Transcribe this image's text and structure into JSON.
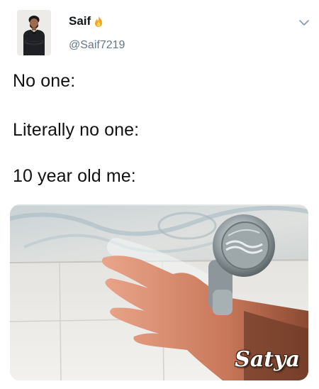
{
  "tweet": {
    "author": {
      "display_name": "Saif",
      "name_emoji_icon": "fire-icon",
      "handle": "@Saif7219"
    },
    "menu_icon": "chevron-down-icon",
    "text_lines": [
      "No one:",
      "Literally no one:",
      "10 year old me:"
    ],
    "media": {
      "watermark": "Satya"
    }
  },
  "colors": {
    "name": "#14171a",
    "handle": "#657786",
    "text": "#111111",
    "chevron": "#8899a6",
    "fire": "#f4a41c"
  }
}
